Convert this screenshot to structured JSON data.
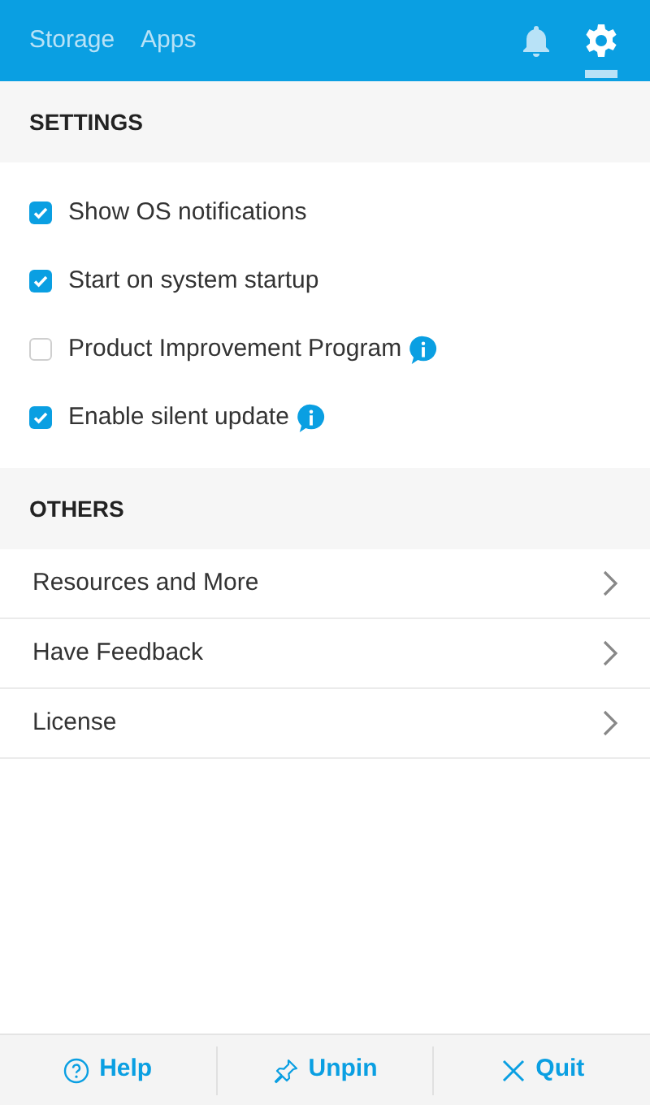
{
  "header": {
    "tabs": [
      {
        "label": "Storage",
        "selected": false
      },
      {
        "label": "Apps",
        "selected": false
      }
    ],
    "icons": [
      {
        "kind": "bell",
        "selected": false
      },
      {
        "kind": "gear",
        "selected": true
      }
    ]
  },
  "settings": {
    "title": "SETTINGS",
    "options": [
      {
        "label": "Show OS notifications",
        "checked": true,
        "info": false
      },
      {
        "label": "Start on system startup",
        "checked": true,
        "info": false
      },
      {
        "label": "Product Improvement Program",
        "checked": false,
        "info": true
      },
      {
        "label": "Enable silent update",
        "checked": true,
        "info": true
      }
    ]
  },
  "others": {
    "title": "OTHERS",
    "items": [
      {
        "label": "Resources and More"
      },
      {
        "label": "Have Feedback"
      },
      {
        "label": "License"
      }
    ]
  },
  "footer": {
    "buttons": [
      {
        "kind": "help",
        "label": "Help"
      },
      {
        "kind": "pin",
        "label": "Unpin"
      },
      {
        "kind": "close",
        "label": "Quit"
      }
    ]
  }
}
